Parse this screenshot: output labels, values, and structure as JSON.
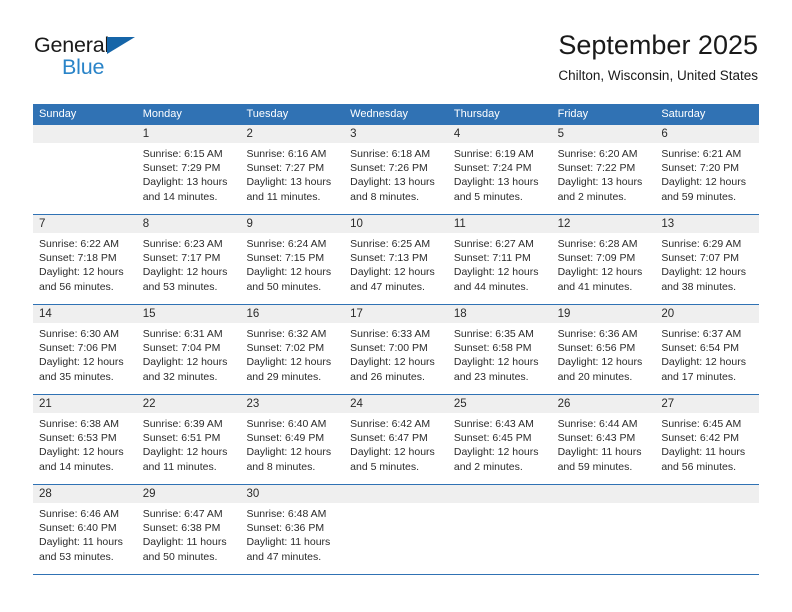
{
  "brand": {
    "name_top": "General",
    "name_bottom": "Blue",
    "triangle_color": "#1565a8",
    "blue_text_color": "#2a84c8"
  },
  "header": {
    "title": "September 2025",
    "subtitle": "Chilton, Wisconsin, United States"
  },
  "theme": {
    "header_blue": "#3072b4",
    "day_number_band": "#efefef",
    "text": "#2b2b2b"
  },
  "calendar": {
    "weekdays": [
      "Sunday",
      "Monday",
      "Tuesday",
      "Wednesday",
      "Thursday",
      "Friday",
      "Saturday"
    ],
    "weeks": [
      [
        {
          "day": "",
          "lines": [
            "",
            "",
            "",
            ""
          ]
        },
        {
          "day": "1",
          "lines": [
            "Sunrise: 6:15 AM",
            "Sunset: 7:29 PM",
            "Daylight: 13 hours",
            "and 14 minutes."
          ]
        },
        {
          "day": "2",
          "lines": [
            "Sunrise: 6:16 AM",
            "Sunset: 7:27 PM",
            "Daylight: 13 hours",
            "and 11 minutes."
          ]
        },
        {
          "day": "3",
          "lines": [
            "Sunrise: 6:18 AM",
            "Sunset: 7:26 PM",
            "Daylight: 13 hours",
            "and 8 minutes."
          ]
        },
        {
          "day": "4",
          "lines": [
            "Sunrise: 6:19 AM",
            "Sunset: 7:24 PM",
            "Daylight: 13 hours",
            "and 5 minutes."
          ]
        },
        {
          "day": "5",
          "lines": [
            "Sunrise: 6:20 AM",
            "Sunset: 7:22 PM",
            "Daylight: 13 hours",
            "and 2 minutes."
          ]
        },
        {
          "day": "6",
          "lines": [
            "Sunrise: 6:21 AM",
            "Sunset: 7:20 PM",
            "Daylight: 12 hours",
            "and 59 minutes."
          ]
        }
      ],
      [
        {
          "day": "7",
          "lines": [
            "Sunrise: 6:22 AM",
            "Sunset: 7:18 PM",
            "Daylight: 12 hours",
            "and 56 minutes."
          ]
        },
        {
          "day": "8",
          "lines": [
            "Sunrise: 6:23 AM",
            "Sunset: 7:17 PM",
            "Daylight: 12 hours",
            "and 53 minutes."
          ]
        },
        {
          "day": "9",
          "lines": [
            "Sunrise: 6:24 AM",
            "Sunset: 7:15 PM",
            "Daylight: 12 hours",
            "and 50 minutes."
          ]
        },
        {
          "day": "10",
          "lines": [
            "Sunrise: 6:25 AM",
            "Sunset: 7:13 PM",
            "Daylight: 12 hours",
            "and 47 minutes."
          ]
        },
        {
          "day": "11",
          "lines": [
            "Sunrise: 6:27 AM",
            "Sunset: 7:11 PM",
            "Daylight: 12 hours",
            "and 44 minutes."
          ]
        },
        {
          "day": "12",
          "lines": [
            "Sunrise: 6:28 AM",
            "Sunset: 7:09 PM",
            "Daylight: 12 hours",
            "and 41 minutes."
          ]
        },
        {
          "day": "13",
          "lines": [
            "Sunrise: 6:29 AM",
            "Sunset: 7:07 PM",
            "Daylight: 12 hours",
            "and 38 minutes."
          ]
        }
      ],
      [
        {
          "day": "14",
          "lines": [
            "Sunrise: 6:30 AM",
            "Sunset: 7:06 PM",
            "Daylight: 12 hours",
            "and 35 minutes."
          ]
        },
        {
          "day": "15",
          "lines": [
            "Sunrise: 6:31 AM",
            "Sunset: 7:04 PM",
            "Daylight: 12 hours",
            "and 32 minutes."
          ]
        },
        {
          "day": "16",
          "lines": [
            "Sunrise: 6:32 AM",
            "Sunset: 7:02 PM",
            "Daylight: 12 hours",
            "and 29 minutes."
          ]
        },
        {
          "day": "17",
          "lines": [
            "Sunrise: 6:33 AM",
            "Sunset: 7:00 PM",
            "Daylight: 12 hours",
            "and 26 minutes."
          ]
        },
        {
          "day": "18",
          "lines": [
            "Sunrise: 6:35 AM",
            "Sunset: 6:58 PM",
            "Daylight: 12 hours",
            "and 23 minutes."
          ]
        },
        {
          "day": "19",
          "lines": [
            "Sunrise: 6:36 AM",
            "Sunset: 6:56 PM",
            "Daylight: 12 hours",
            "and 20 minutes."
          ]
        },
        {
          "day": "20",
          "lines": [
            "Sunrise: 6:37 AM",
            "Sunset: 6:54 PM",
            "Daylight: 12 hours",
            "and 17 minutes."
          ]
        }
      ],
      [
        {
          "day": "21",
          "lines": [
            "Sunrise: 6:38 AM",
            "Sunset: 6:53 PM",
            "Daylight: 12 hours",
            "and 14 minutes."
          ]
        },
        {
          "day": "22",
          "lines": [
            "Sunrise: 6:39 AM",
            "Sunset: 6:51 PM",
            "Daylight: 12 hours",
            "and 11 minutes."
          ]
        },
        {
          "day": "23",
          "lines": [
            "Sunrise: 6:40 AM",
            "Sunset: 6:49 PM",
            "Daylight: 12 hours",
            "and 8 minutes."
          ]
        },
        {
          "day": "24",
          "lines": [
            "Sunrise: 6:42 AM",
            "Sunset: 6:47 PM",
            "Daylight: 12 hours",
            "and 5 minutes."
          ]
        },
        {
          "day": "25",
          "lines": [
            "Sunrise: 6:43 AM",
            "Sunset: 6:45 PM",
            "Daylight: 12 hours",
            "and 2 minutes."
          ]
        },
        {
          "day": "26",
          "lines": [
            "Sunrise: 6:44 AM",
            "Sunset: 6:43 PM",
            "Daylight: 11 hours",
            "and 59 minutes."
          ]
        },
        {
          "day": "27",
          "lines": [
            "Sunrise: 6:45 AM",
            "Sunset: 6:42 PM",
            "Daylight: 11 hours",
            "and 56 minutes."
          ]
        }
      ],
      [
        {
          "day": "28",
          "lines": [
            "Sunrise: 6:46 AM",
            "Sunset: 6:40 PM",
            "Daylight: 11 hours",
            "and 53 minutes."
          ]
        },
        {
          "day": "29",
          "lines": [
            "Sunrise: 6:47 AM",
            "Sunset: 6:38 PM",
            "Daylight: 11 hours",
            "and 50 minutes."
          ]
        },
        {
          "day": "30",
          "lines": [
            "Sunrise: 6:48 AM",
            "Sunset: 6:36 PM",
            "Daylight: 11 hours",
            "and 47 minutes."
          ]
        },
        {
          "day": "",
          "lines": [
            "",
            "",
            "",
            ""
          ]
        },
        {
          "day": "",
          "lines": [
            "",
            "",
            "",
            ""
          ]
        },
        {
          "day": "",
          "lines": [
            "",
            "",
            "",
            ""
          ]
        },
        {
          "day": "",
          "lines": [
            "",
            "",
            "",
            ""
          ]
        }
      ]
    ]
  }
}
